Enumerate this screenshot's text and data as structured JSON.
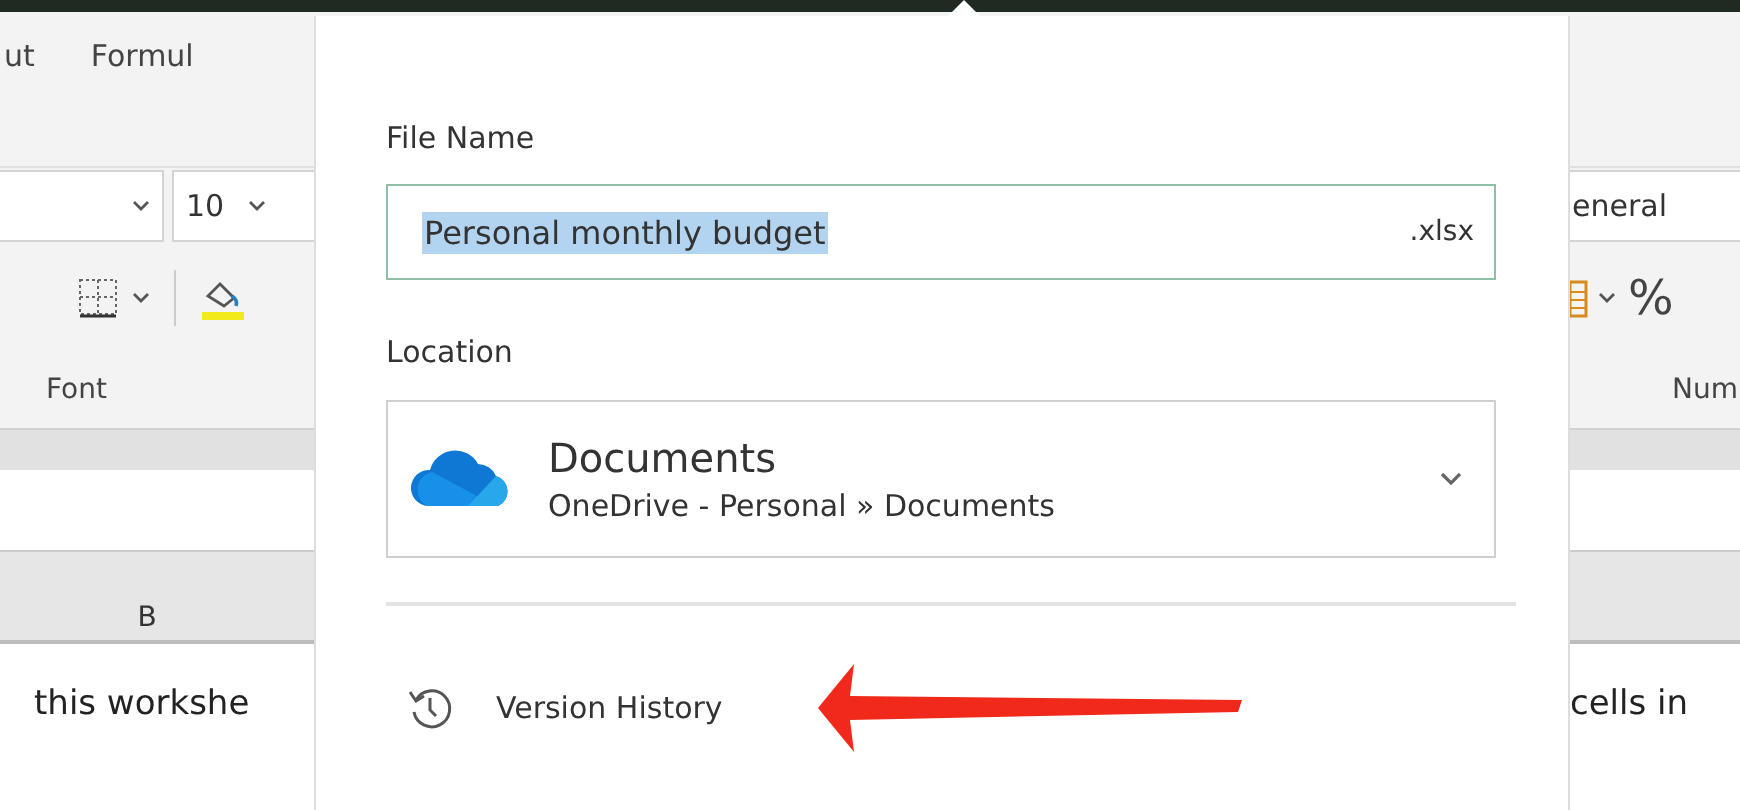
{
  "ribbon_left": {
    "tabs": [
      "ut",
      "Formul"
    ],
    "font_size": "10",
    "group_label": "Font",
    "column_header": "B",
    "cell_text": "this workshe"
  },
  "ribbon_right": {
    "number_format": "eneral",
    "percent": "%",
    "group_label": "Num",
    "cell_text": "cells in"
  },
  "save_popup": {
    "file_name": {
      "label": "File Name",
      "value": "Personal monthly budget",
      "value_highlighted": true,
      "extension": ".xlsx"
    },
    "location": {
      "label": "Location",
      "folder": "Documents",
      "path": "OneDrive - Personal » Documents"
    },
    "actions": [
      {
        "kind": "history",
        "label": "Version History"
      }
    ],
    "annotation": {
      "kind": "arrow"
    }
  }
}
